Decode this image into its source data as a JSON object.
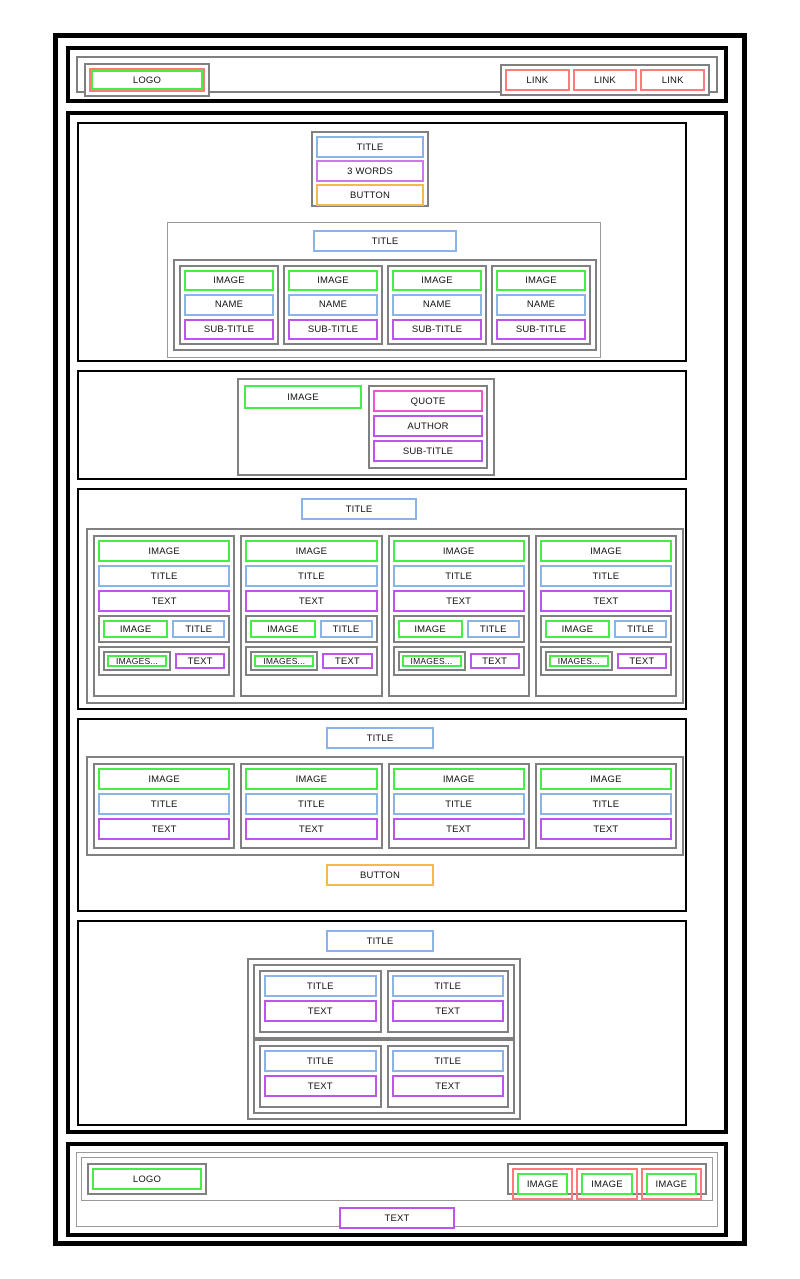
{
  "page": {
    "type": "website-wireframe-mockup",
    "colors": {
      "image": "#44ee44",
      "title": "#8ab4e8",
      "text": "#cc77ee",
      "violet": "#bb55ee",
      "quote": "#ee55cc",
      "button": "#f5b84c",
      "link": "#ff7b7b",
      "container": "#808080",
      "frame": "#000000"
    }
  },
  "header": {
    "logo": "LOGO",
    "links": [
      "LINK",
      "LINK",
      "LINK"
    ]
  },
  "hero": {
    "title": "TITLE",
    "tagline": "3 WORDS",
    "button": "BUTTON"
  },
  "team": {
    "title": "TITLE",
    "members": [
      {
        "image": "IMAGE",
        "name": "NAME",
        "subtitle": "SUB-TITLE"
      },
      {
        "image": "IMAGE",
        "name": "NAME",
        "subtitle": "SUB-TITLE"
      },
      {
        "image": "IMAGE",
        "name": "NAME",
        "subtitle": "SUB-TITLE"
      },
      {
        "image": "IMAGE",
        "name": "NAME",
        "subtitle": "SUB-TITLE"
      }
    ]
  },
  "quote": {
    "image": "IMAGE",
    "quote": "QUOTE",
    "author": "AUTHOR",
    "subtitle": "SUB-TITLE"
  },
  "blog": {
    "title": "TITLE",
    "cards": [
      {
        "image": "IMAGE",
        "title": "TITLE",
        "text": "TEXT",
        "sub_image": "IMAGE",
        "sub_title": "TITLE",
        "gallery": "IMAGES...",
        "gallery_text": "TEXT"
      },
      {
        "image": "IMAGE",
        "title": "TITLE",
        "text": "TEXT",
        "sub_image": "IMAGE",
        "sub_title": "TITLE",
        "gallery": "IMAGES...",
        "gallery_text": "TEXT"
      },
      {
        "image": "IMAGE",
        "title": "TITLE",
        "text": "TEXT",
        "sub_image": "IMAGE",
        "sub_title": "TITLE",
        "gallery": "IMAGES...",
        "gallery_text": "TEXT"
      },
      {
        "image": "IMAGE",
        "title": "TITLE",
        "text": "TEXT",
        "sub_image": "IMAGE",
        "sub_title": "TITLE",
        "gallery": "IMAGES...",
        "gallery_text": "TEXT"
      }
    ]
  },
  "features": {
    "title": "TITLE",
    "button": "BUTTON",
    "cards": [
      {
        "image": "IMAGE",
        "title": "TITLE",
        "text": "TEXT"
      },
      {
        "image": "IMAGE",
        "title": "TITLE",
        "text": "TEXT"
      },
      {
        "image": "IMAGE",
        "title": "TITLE",
        "text": "TEXT"
      },
      {
        "image": "IMAGE",
        "title": "TITLE",
        "text": "TEXT"
      }
    ]
  },
  "faq": {
    "title": "TITLE",
    "items": [
      {
        "title": "TITLE",
        "text": "TEXT"
      },
      {
        "title": "TITLE",
        "text": "TEXT"
      },
      {
        "title": "TITLE",
        "text": "TEXT"
      },
      {
        "title": "TITLE",
        "text": "TEXT"
      }
    ]
  },
  "footer": {
    "logo": "LOGO",
    "social": [
      "IMAGE",
      "IMAGE",
      "IMAGE"
    ],
    "text": "TEXT"
  }
}
